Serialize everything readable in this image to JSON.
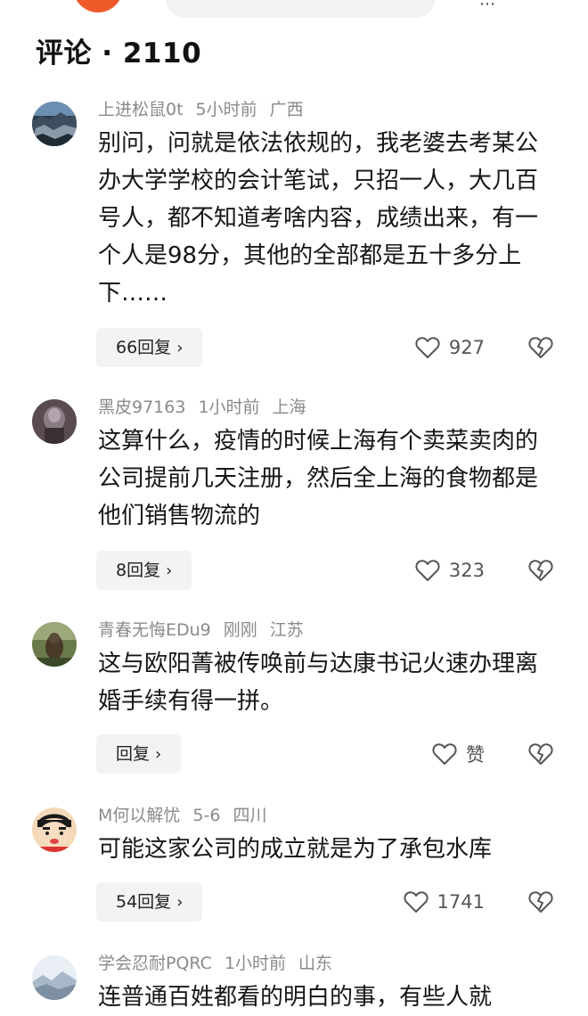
{
  "header": {
    "title": "评论 · 2110"
  },
  "icons": {
    "like": "heart-outline-icon",
    "dislike": "broken-heart-icon",
    "chevron": "chevron-right-icon"
  },
  "comments": [
    {
      "username": "上进松鼠0t",
      "time": "5小时前",
      "location": "广西",
      "text": "别问，问就是依法依规的，我老婆去考某公办大学学校的会计笔试，只招一人，大几百号人，都不知道考啥内容，成绩出来，有一个人是98分，其他的全部都是五十多分上下……",
      "reply_label": "66回复",
      "like_label": "927"
    },
    {
      "username": "黑皮97163",
      "time": "1小时前",
      "location": "上海",
      "text": "这算什么，疫情的时候上海有个卖菜卖肉的公司提前几天注册，然后全上海的食物都是他们销售物流的",
      "reply_label": "8回复",
      "like_label": "323"
    },
    {
      "username": "青春无悔EDu9",
      "time": "刚刚",
      "location": "江苏",
      "text": "这与欧阳菁被传唤前与达康书记火速办理离婚手续有得一拼。",
      "reply_label": "回复",
      "like_label": "赞"
    },
    {
      "username": "M何以解忧",
      "time": "5-6",
      "location": "四川",
      "text": "可能这家公司的成立就是为了承包水库",
      "reply_label": "54回复",
      "like_label": "1741"
    },
    {
      "username": "学会忍耐PQRC",
      "time": "1小时前",
      "location": "山东",
      "text": "连普通百姓都看的明白的事，有些人就"
    }
  ]
}
